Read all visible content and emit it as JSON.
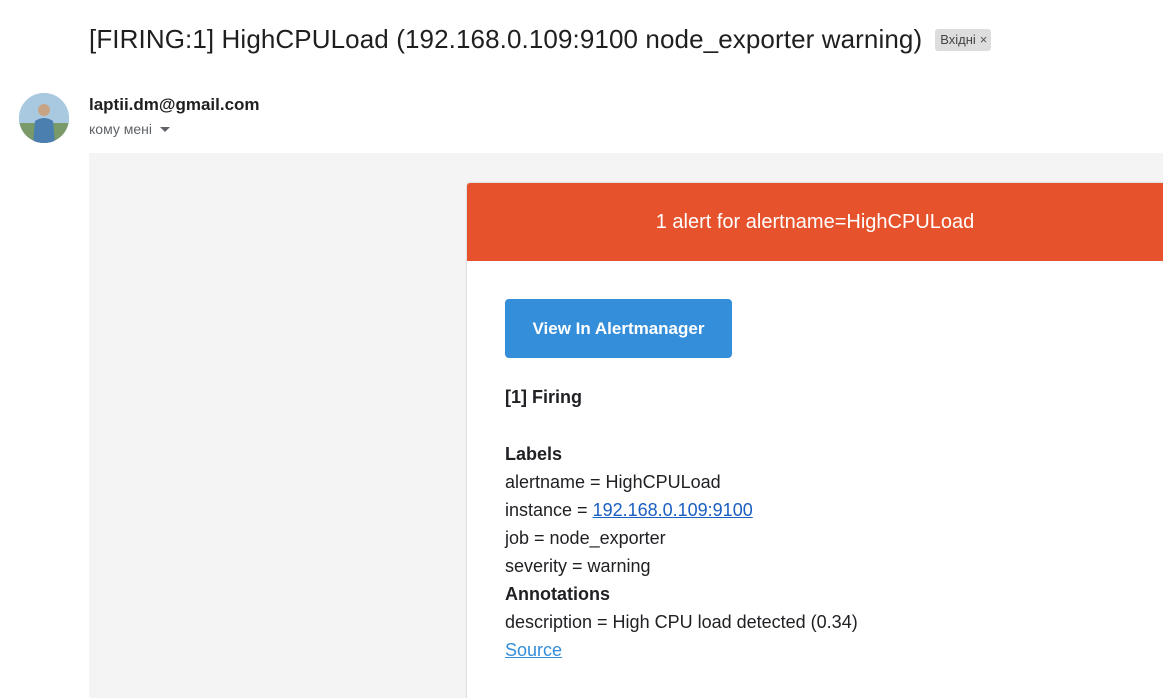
{
  "email": {
    "subject": "[FIRING:1] HighCPULoad (192.168.0.109:9100 node_exporter warning)",
    "label": "Вхідні",
    "label_close": "×",
    "sender": "laptii.dm@gmail.com",
    "recipient": "кому мені"
  },
  "alert": {
    "header": "1 alert for alertname=HighCPULoad",
    "button_label": "View In Alertmanager",
    "firing_title": "[1] Firing",
    "labels_heading": "Labels",
    "labels": {
      "alertname": "alertname = HighCPULoad",
      "instance_prefix": "instance = ",
      "instance_link": "192.168.0.109:9100",
      "job": "job = node_exporter",
      "severity": "severity = warning"
    },
    "annotations_heading": "Annotations",
    "description": "description = High CPU load detected (0.34)",
    "source_link": "Source"
  },
  "colors": {
    "header_bg": "#e6522c",
    "button_bg": "#348eda",
    "link": "#1a5fc2"
  },
  "icons": [
    "avatar",
    "chevron-down-icon",
    "close-icon"
  ]
}
